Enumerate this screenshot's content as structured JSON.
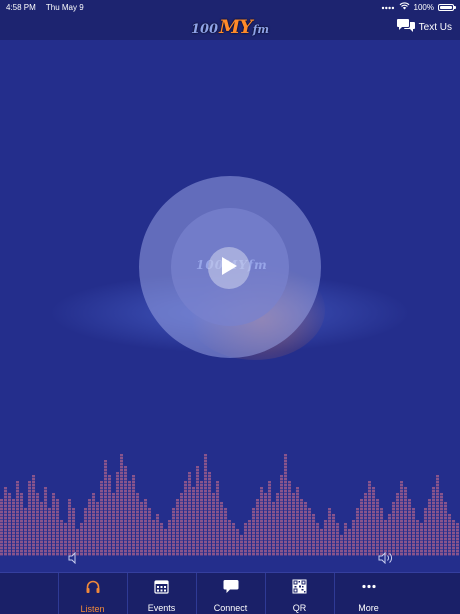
{
  "status_bar": {
    "time": "4:58 PM",
    "date": "Thu May 9",
    "battery": "100%",
    "battery_level": 1.0
  },
  "header": {
    "logo": {
      "num": "100",
      "my": "MY",
      "fm": "fm"
    },
    "text_us_label": "Text Us",
    "text_us_icon": "chat-bubbles-icon"
  },
  "player": {
    "disc_logo": "100MYfm",
    "play_icon": "play-icon"
  },
  "equalizer": {
    "bar_color": "#9a5a8c",
    "levels": [
      0.55,
      0.65,
      0.6,
      0.55,
      0.7,
      0.6,
      0.45,
      0.7,
      0.75,
      0.6,
      0.5,
      0.65,
      0.45,
      0.6,
      0.55,
      0.35,
      0.3,
      0.55,
      0.45,
      0.25,
      0.3,
      0.45,
      0.55,
      0.6,
      0.5,
      0.7,
      0.9,
      0.75,
      0.6,
      0.8,
      0.95,
      0.85,
      0.7,
      0.75,
      0.6,
      0.5,
      0.55,
      0.45,
      0.35,
      0.4,
      0.3,
      0.25,
      0.35,
      0.45,
      0.55,
      0.6,
      0.7,
      0.8,
      0.65,
      0.85,
      0.7,
      0.95,
      0.8,
      0.6,
      0.7,
      0.5,
      0.45,
      0.35,
      0.3,
      0.25,
      0.2,
      0.3,
      0.35,
      0.45,
      0.55,
      0.65,
      0.6,
      0.7,
      0.5,
      0.6,
      0.75,
      0.95,
      0.7,
      0.6,
      0.65,
      0.55,
      0.5,
      0.45,
      0.4,
      0.3,
      0.25,
      0.35,
      0.45,
      0.4,
      0.3,
      0.2,
      0.3,
      0.25,
      0.35,
      0.45,
      0.55,
      0.6,
      0.7,
      0.65,
      0.55,
      0.45,
      0.35,
      0.4,
      0.5,
      0.6,
      0.7,
      0.65,
      0.55,
      0.45,
      0.35,
      0.3,
      0.45,
      0.55,
      0.65,
      0.75,
      0.6,
      0.5,
      0.4,
      0.35,
      0.3
    ]
  },
  "volume": {
    "low_icon": "volume-low-icon",
    "high_icon": "volume-high-icon"
  },
  "colors": {
    "background": "#242e8c",
    "bar": "#1d2470",
    "tab_bar": "#1a2068",
    "accent": "#f0893a",
    "logo_orange": "#ff8a2a",
    "logo_blue": "#8fa3e8"
  },
  "tabs": [
    {
      "label": "Listen",
      "icon": "headphones-icon",
      "active": true
    },
    {
      "label": "Events",
      "icon": "calendar-icon",
      "active": false
    },
    {
      "label": "Connect",
      "icon": "chat-bubble-icon",
      "active": false
    },
    {
      "label": "QR",
      "icon": "qr-code-icon",
      "active": false
    },
    {
      "label": "More",
      "icon": "more-dots-icon",
      "active": false
    }
  ]
}
